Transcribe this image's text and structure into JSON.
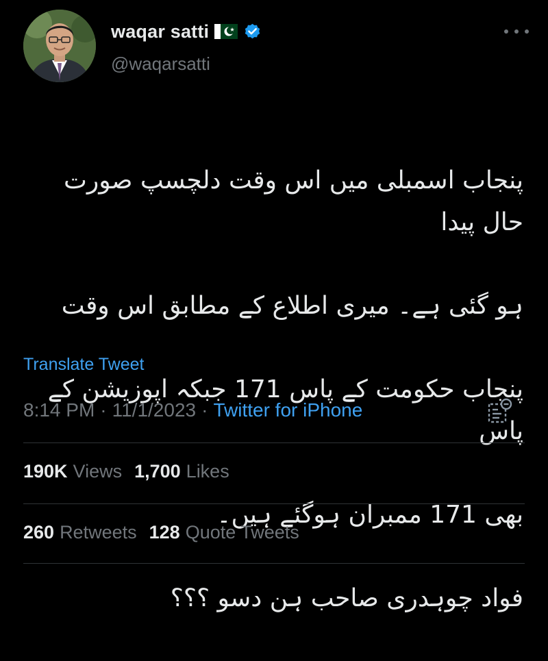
{
  "author": {
    "display_name": "waqar satti",
    "handle": "@waqarsatti",
    "flag_icon": "pakistan-flag-icon",
    "verified_icon": "verified-badge-icon",
    "verified_color": "#1d9bf0"
  },
  "tweet": {
    "lines": [
      "پنجاب اسمبلی میں اس وقت دلچسپ صورت حال پیدا",
      "ہو گئی ہے۔ میری اطلاع کے مطابق اس وقت",
      "پنجاب حکومت کے پاس 171 جبکہ اپوزیشن کے پاس",
      "بھی 171 ممبران ہوگئے ہیں۔",
      "فواد چوہدری صاحب ہن دسو ؟؟؟"
    ],
    "translate_label": "Translate Tweet",
    "time": "8:14 PM",
    "date": "11/1/2023",
    "separator": "·",
    "source": "Twitter for iPhone"
  },
  "stats": {
    "views_count": "190K",
    "views_label": "Views",
    "likes_count": "1,700",
    "likes_label": "Likes",
    "retweets_count": "260",
    "retweets_label": "Retweets",
    "quotes_count": "128",
    "quotes_label": "Quote Tweets"
  },
  "icons": {
    "more": "more-options-icon",
    "analytics": "tweet-analytics-icon"
  },
  "colors": {
    "background": "#000000",
    "text": "#e7e9ea",
    "muted": "#71767b",
    "link": "#3fa1f1",
    "divider": "#2f3336"
  }
}
